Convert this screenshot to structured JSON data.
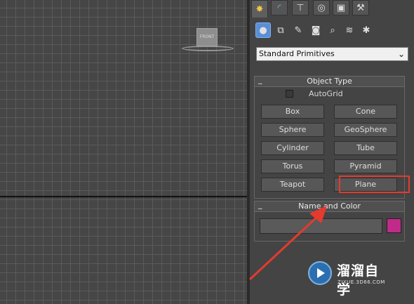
{
  "viewport": {
    "viewcube_label": "FRONT"
  },
  "command_panel": {
    "tabs": [
      {
        "name": "create",
        "icon": "sun-star-icon",
        "glyph": "✸",
        "active": true
      },
      {
        "name": "modify",
        "icon": "curve-icon",
        "glyph": "◜",
        "active": false
      },
      {
        "name": "hierarchy",
        "icon": "hierarchy-icon",
        "glyph": "⊤",
        "active": false
      },
      {
        "name": "motion",
        "icon": "motion-icon",
        "glyph": "◎",
        "active": false
      },
      {
        "name": "display",
        "icon": "monitor-icon",
        "glyph": "▣",
        "active": false
      },
      {
        "name": "utilities",
        "icon": "hammer-icon",
        "glyph": "⚒",
        "active": false
      }
    ],
    "subcategories": [
      {
        "icon": "geometry-sphere-icon",
        "glyph": "●",
        "active": true
      },
      {
        "icon": "shapes-icon",
        "glyph": "⧉",
        "active": false
      },
      {
        "icon": "lights-icon",
        "glyph": "✎",
        "active": false
      },
      {
        "icon": "cameras-icon",
        "glyph": "◙",
        "active": false
      },
      {
        "icon": "helpers-icon",
        "glyph": "⌕",
        "active": false
      },
      {
        "icon": "spacewarps-icon",
        "glyph": "≋",
        "active": false
      },
      {
        "icon": "systems-icon",
        "glyph": "✱",
        "active": false
      }
    ],
    "category_dropdown": {
      "value": "Standard Primitives"
    },
    "object_type": {
      "title": "Object Type",
      "collapse": "_",
      "autogrid_label": "AutoGrid",
      "buttons": [
        "Box",
        "Cone",
        "Sphere",
        "GeoSphere",
        "Cylinder",
        "Tube",
        "Torus",
        "Pyramid",
        "Teapot",
        "Plane"
      ],
      "highlighted": "Plane"
    },
    "name_and_color": {
      "title": "Name and Color",
      "collapse": "_",
      "name_value": "",
      "color": "#c22a8a"
    }
  },
  "watermark": {
    "name": "溜溜自学",
    "url": "ZIXUE.3D66.COM"
  },
  "colors": {
    "highlight": "#e53a2e",
    "arrow": "#e53a2e",
    "swatch": "#c22a8a"
  }
}
